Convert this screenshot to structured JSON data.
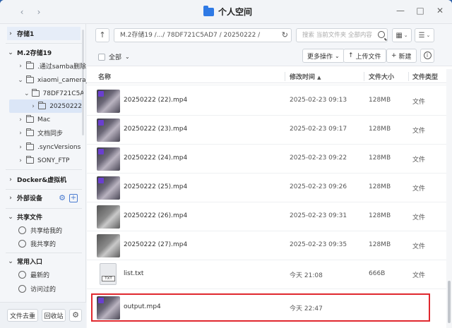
{
  "window": {
    "title": "个人空间"
  },
  "sidebar": {
    "storage1": "存储1",
    "storage19": "M.2存储19",
    "tree": [
      {
        "label": ".通过samba删除"
      },
      {
        "label": "xiaomi_camera_"
      },
      {
        "label": "78DF721C5A"
      },
      {
        "label": "20250222"
      },
      {
        "label": "Mac"
      },
      {
        "label": "文档同步"
      },
      {
        "label": ".syncVersions"
      },
      {
        "label": "SONY_FTP"
      }
    ],
    "docker": "Docker&虚拟机",
    "external": "外部设备",
    "shared_title": "共享文件",
    "shared_to_me": "共享给我的",
    "my_shares": "我共享的",
    "common_title": "常用入口",
    "recent": "最新的",
    "visited": "访问过的",
    "trash_btn": "文件去重",
    "recycle_btn": "回收站"
  },
  "pathbar": {
    "path": "M.2存储19 /.../ 78DF721C5AD7 / 20250222 /",
    "search_placeholder": "搜索 当前文件夹 全部内容"
  },
  "toolbar": {
    "select_all": "全部",
    "more_ops": "更多操作",
    "upload": "上传文件",
    "new": "新建"
  },
  "table": {
    "headers": {
      "name": "名称",
      "mtime": "修改时间",
      "size": "文件大小",
      "type": "文件类型"
    },
    "rows": [
      {
        "name": "20250222 (22).mp4",
        "mtime": "2025-02-23 09:13",
        "size": "128MB",
        "type": "文件"
      },
      {
        "name": "20250222 (23).mp4",
        "mtime": "2025-02-23 09:17",
        "size": "128MB",
        "type": "文件"
      },
      {
        "name": "20250222 (24).mp4",
        "mtime": "2025-02-23 09:22",
        "size": "128MB",
        "type": "文件"
      },
      {
        "name": "20250222 (25).mp4",
        "mtime": "2025-02-23 09:26",
        "size": "128MB",
        "type": "文件"
      },
      {
        "name": "20250222 (26).mp4",
        "mtime": "2025-02-23 09:31",
        "size": "128MB",
        "type": "文件"
      },
      {
        "name": "20250222 (27).mp4",
        "mtime": "2025-02-23 09:35",
        "size": "128MB",
        "type": "文件"
      },
      {
        "name": "list.txt",
        "mtime": "今天 21:08",
        "size": "666B",
        "type": "文件"
      },
      {
        "name": "output.mp4",
        "mtime": "今天 22:47",
        "size": "",
        "type": ""
      }
    ],
    "txt_label": "TXT"
  },
  "colors": {
    "accent": "#2f7ae5",
    "outline": "#e0282e"
  }
}
